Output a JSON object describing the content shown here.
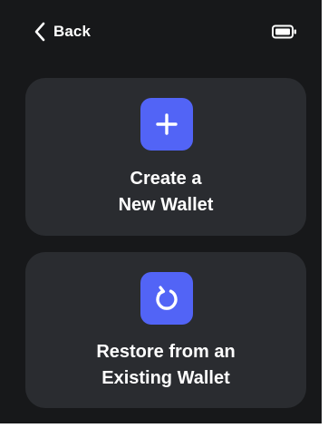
{
  "colors": {
    "screen_background": "#17181a",
    "card_background": "#2a2c30",
    "icon_accent": "#5264f6",
    "text": "#ffffff"
  },
  "header": {
    "back_label": "Back",
    "back_icon": "chevron-left-icon",
    "battery_icon": "battery-icon"
  },
  "options": [
    {
      "icon": "plus-icon",
      "title_line1": "Create a",
      "title_line2": "New Wallet"
    },
    {
      "icon": "restore-icon",
      "title_line1": "Restore from an",
      "title_line2": "Existing Wallet"
    }
  ]
}
